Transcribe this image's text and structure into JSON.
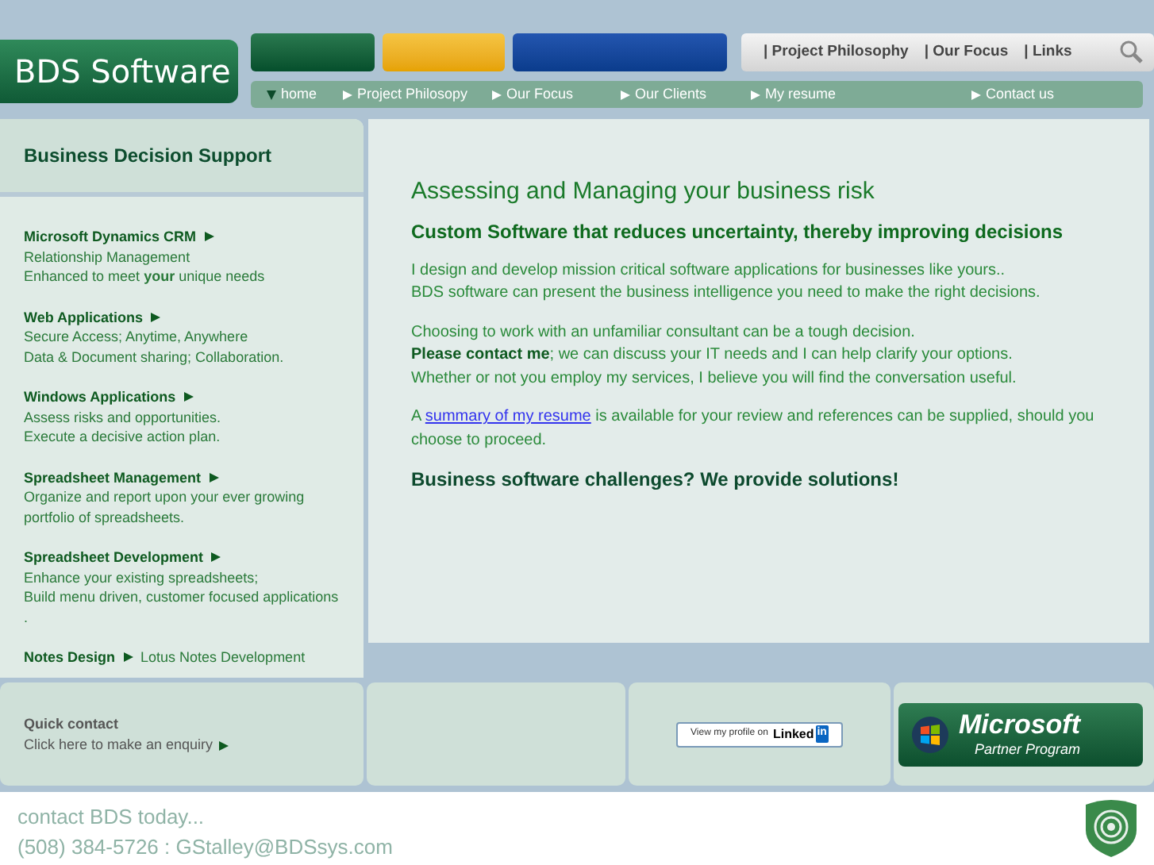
{
  "logo": "BDS Software",
  "top_links": [
    "| Project Philosophy",
    "| Our Focus",
    "| Links"
  ],
  "nav": [
    {
      "label": "home",
      "selected": true
    },
    {
      "label": "Project Philosopy",
      "selected": false
    },
    {
      "label": "Our Focus",
      "selected": false
    },
    {
      "label": "Our Clients",
      "selected": false
    },
    {
      "label": "My resume",
      "selected": false
    },
    {
      "label": "Contact us",
      "selected": false
    }
  ],
  "sidebar": {
    "title": "Business Decision Support",
    "items": [
      {
        "title": "Microsoft Dynamics CRM",
        "lines": [
          "Relationship Management",
          "Enhanced to meet **your** unique needs"
        ]
      },
      {
        "title": "Web Applications",
        "lines": [
          "Secure Access; Anytime, Anywhere",
          "Data & Document sharing; Collaboration."
        ]
      },
      {
        "title": "Windows Applications",
        "lines": [
          "Assess risks and opportunities.",
          "Execute a decisive action plan."
        ]
      },
      {
        "title": "Spreadsheet Management",
        "lines": [
          "Organize and report upon your ever growing portfolio of spreadsheets."
        ]
      },
      {
        "title": "Spreadsheet Development",
        "lines": [
          "Enhance your existing spreadsheets;",
          "Build menu driven, customer focused applications",
          "."
        ]
      },
      {
        "title": "Notes Design",
        "inline": "Lotus Notes Development"
      }
    ]
  },
  "content": {
    "title": "Assessing and Managing your business risk",
    "subtitle": "Custom Software that reduces uncertainty, thereby improving decisions",
    "paragraphs": [
      [
        "I design and develop mission critical software applications for businesses like yours..",
        "BDS software can present the business intelligence you need to make the right decisions."
      ],
      [
        "Choosing to work with an unfamiliar consultant can be a tough decision.",
        "**Please contact me**; we can discuss your IT needs and I can help clarify your options.",
        "Whether or not you employ my services, I believe you will find the conversation useful."
      ]
    ],
    "resume": {
      "before": "A ",
      "link": "summary of my resume",
      "after": " is available for your review and references can be supplied, should you choose to proceed."
    },
    "tagline": "Business software challenges? We provide solutions!"
  },
  "quick_contact": {
    "title": "Quick contact",
    "link": "Click here to make an enquiry"
  },
  "linkedin": {
    "text": "View my profile on",
    "brand": "Linked",
    "badge": "in"
  },
  "ms_partner": {
    "brand": "Microsoft",
    "program": "Partner Program"
  },
  "footer": {
    "lines": [
      "contact BDS today...",
      "(508) 384-5726 : GStalley@BDSsys.com"
    ]
  }
}
